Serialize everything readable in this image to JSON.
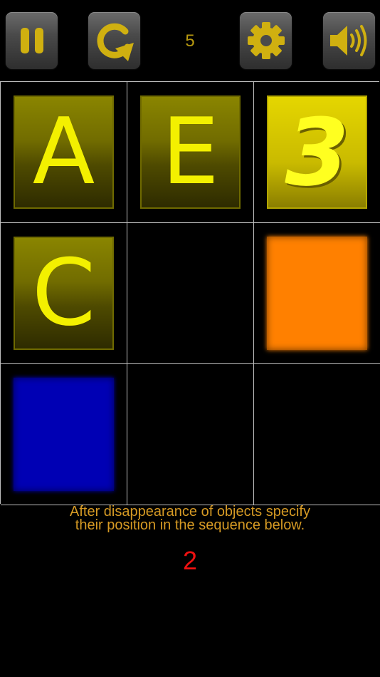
{
  "toolbar": {
    "counter": "5",
    "buttons": [
      {
        "name": "pause",
        "icon": "pause-icon"
      },
      {
        "name": "restart",
        "icon": "restart-icon"
      },
      {
        "name": "settings",
        "icon": "gear-icon"
      },
      {
        "name": "sound",
        "icon": "speaker-icon"
      }
    ],
    "icon_color": "#d0b010"
  },
  "grid": {
    "rows": 3,
    "cols": 3,
    "cells": [
      {
        "type": "letter",
        "text": "A"
      },
      {
        "type": "letter",
        "text": "E"
      },
      {
        "type": "digit",
        "text": "3"
      },
      {
        "type": "letter",
        "text": "C"
      },
      {
        "type": "empty"
      },
      {
        "type": "color",
        "color": "#ff8000"
      },
      {
        "type": "color",
        "color": "#0000b4"
      },
      {
        "type": "empty"
      },
      {
        "type": "empty"
      }
    ]
  },
  "instruction": {
    "line1": "After disappearance of objects specify",
    "line2": "their position in the sequence below."
  },
  "answer": "2"
}
